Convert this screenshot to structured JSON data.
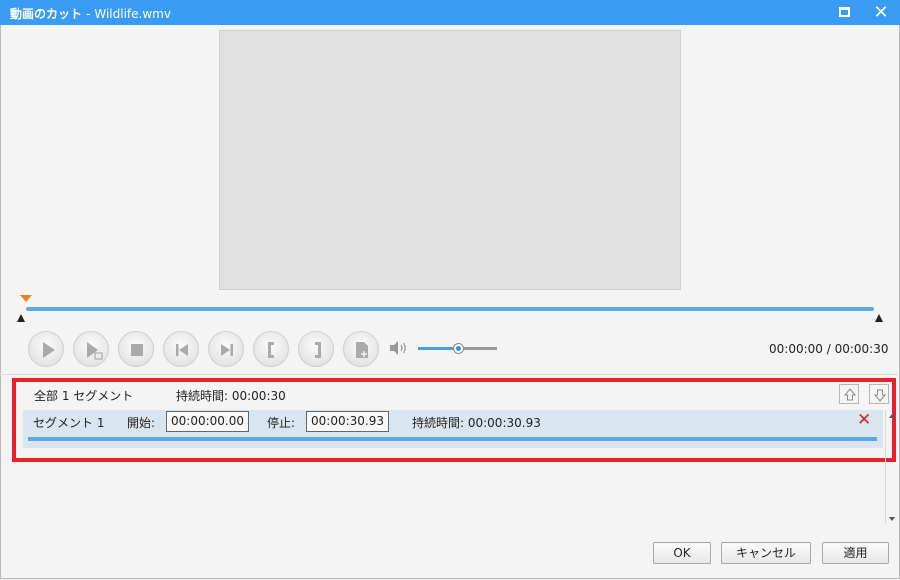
{
  "window": {
    "title": "動画のカット",
    "filename": "- Wildlife.wmv",
    "maximize_icon": "maximize-icon",
    "close_icon": "close-icon",
    "close_glyph": "✕"
  },
  "player": {
    "controls": [
      "play-icon",
      "play-segment-icon",
      "stop-icon",
      "previous-frame-icon",
      "next-frame-icon",
      "set-start-icon",
      "set-end-icon",
      "add-segment-icon"
    ],
    "volume_icon": "speaker-icon",
    "volume_level": 0.5,
    "playhead_position": 0,
    "time_display": "00:00:00 / 00:00:30"
  },
  "segments": {
    "summary_label": "全部 1 セグメント",
    "summary_duration": "持続時間: 00:00:30",
    "move_up_icon": "arrow-up-icon",
    "move_down_icon": "arrow-down-icon",
    "rows": [
      {
        "name": "セグメント 1",
        "start_label": "開始:",
        "start_value": "00:00:00.00",
        "end_label": "停止:",
        "end_value": "00:00:30.93",
        "duration_label": "持続時間: 00:00:30.93",
        "delete_glyph": "✕"
      }
    ]
  },
  "buttons": {
    "ok": "OK",
    "cancel": "キャンセル",
    "apply": "適用"
  },
  "colors": {
    "titlebar": "#3a9bf2",
    "timeline": "#59a9e6",
    "playhead": "#f08020",
    "highlight_border": "#e8202a",
    "delete": "#e02020"
  }
}
